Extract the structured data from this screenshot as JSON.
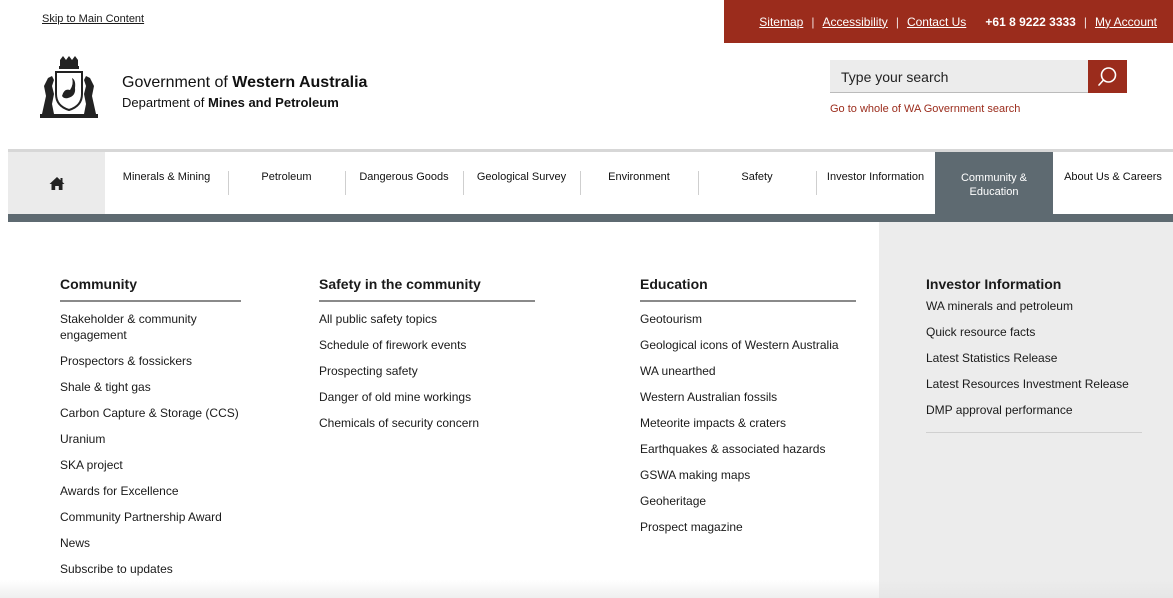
{
  "skip_link": "Skip to Main Content",
  "utility": {
    "sitemap": "Sitemap",
    "accessibility": "Accessibility",
    "contact": "Contact Us",
    "phone": "+61 8 9222 3333",
    "account": "My Account",
    "separator": "|",
    "color": "#9b2c1c"
  },
  "header": {
    "gov_prefix": "Government of ",
    "gov_strong": "Western Australia",
    "dept_prefix": "Department of ",
    "dept_strong": "Mines and Petroleum",
    "crest_icon": "wa-coat-of-arms-icon"
  },
  "search": {
    "placeholder": "Type your search",
    "icon": "search-icon",
    "wa_link": "Go to whole of WA Government search"
  },
  "nav": {
    "home_icon": "home-icon",
    "items": [
      {
        "label": "Minerals & Mining"
      },
      {
        "label": "Petroleum"
      },
      {
        "label": "Dangerous Goods"
      },
      {
        "label": "Geological Survey"
      },
      {
        "label": "Environment"
      },
      {
        "label": "Safety"
      },
      {
        "label": "Investor Information"
      },
      {
        "label": "Community &\nEducation",
        "active": true
      },
      {
        "label": "About Us & Careers"
      }
    ],
    "active_color": "#5e6a71"
  },
  "menu": {
    "community": {
      "heading": "Community",
      "items": [
        "Stakeholder & community engagement",
        "Prospectors & fossickers",
        "Shale & tight gas",
        "Carbon Capture & Storage (CCS)",
        "Uranium",
        "SKA project",
        "Awards for Excellence",
        "Community Partnership Award",
        "News",
        "Subscribe to updates"
      ]
    },
    "safety": {
      "heading": "Safety in the community",
      "items": [
        "All public safety topics",
        "Schedule of firework events",
        "Prospecting safety",
        "Danger of old mine workings",
        "Chemicals of security concern"
      ]
    },
    "education": {
      "heading": "Education",
      "items": [
        "Geotourism",
        "Geological icons of Western Australia",
        "WA unearthed",
        "Western Australian fossils",
        "Meteorite impacts & craters",
        "Earthquakes & associated hazards",
        "GSWA making maps",
        "Geoheritage",
        "Prospect magazine"
      ]
    },
    "investor": {
      "heading": "Investor Information",
      "items": [
        "WA minerals and petroleum",
        "Quick resource facts",
        "Latest Statistics Release",
        "Latest Resources Investment Release",
        "DMP approval performance"
      ]
    }
  }
}
